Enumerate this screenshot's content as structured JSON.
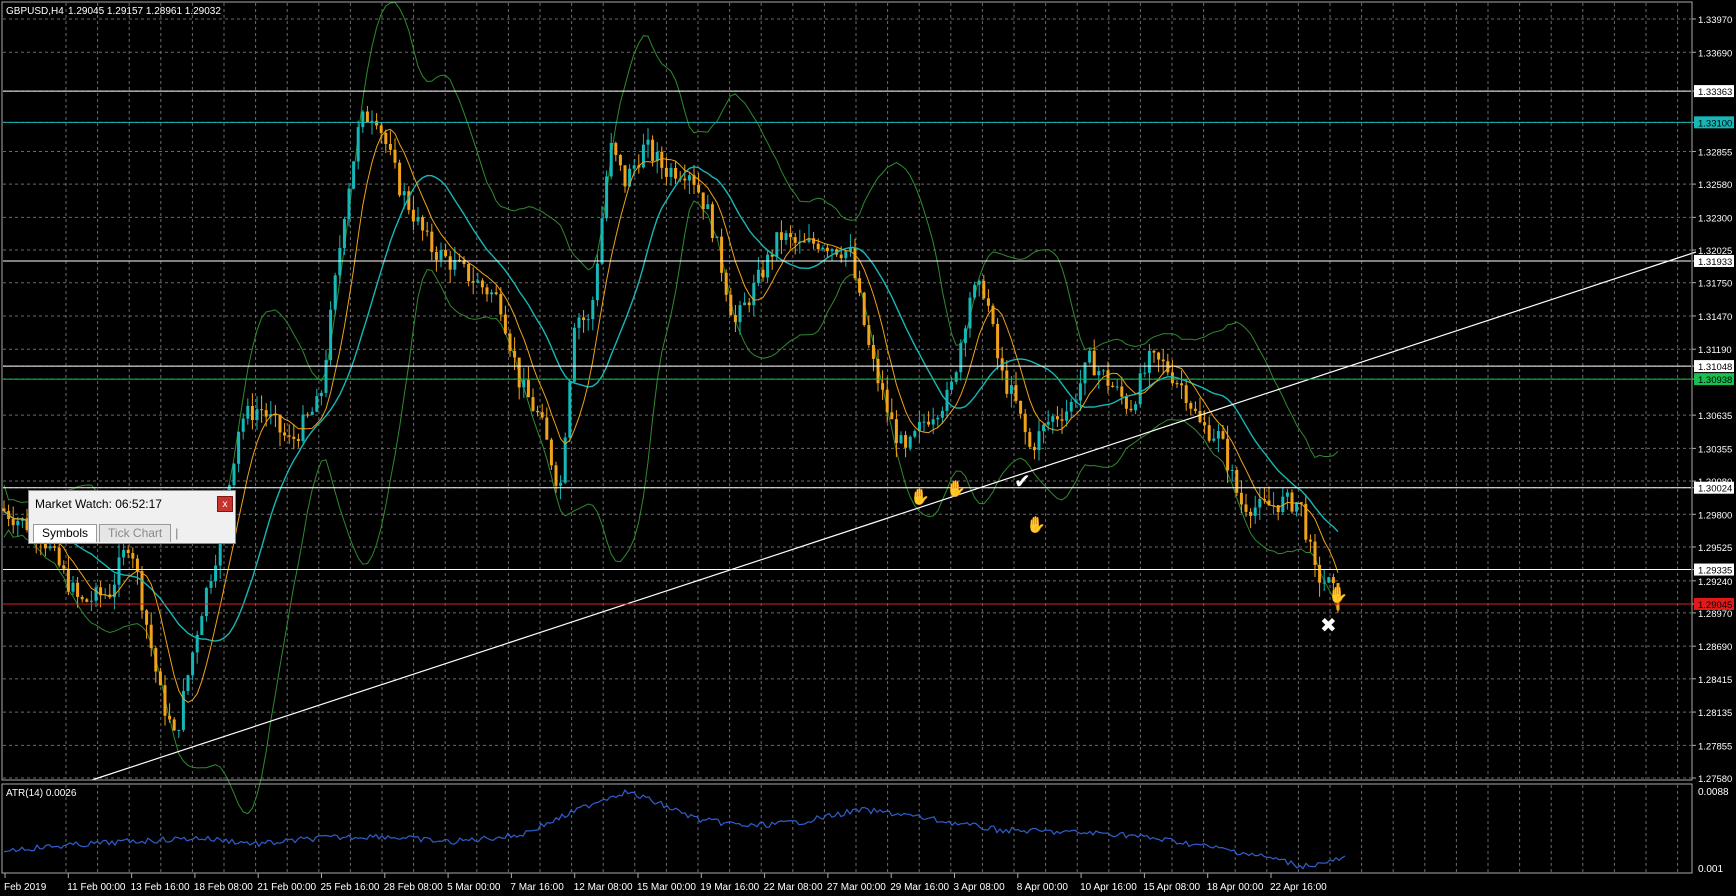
{
  "header": {
    "symbol": "GBPUSD,H4",
    "ohlc": "1.29045 1.29157 1.28961 1.29032"
  },
  "price_axis": {
    "labels": [
      "1.33970",
      "1.33690",
      "1.33363",
      "1.33100",
      "1.32855",
      "1.32580",
      "1.32300",
      "1.32025",
      "1.31933",
      "1.31750",
      "1.31470",
      "1.31190",
      "1.31048",
      "1.30938",
      "1.30635",
      "1.30355",
      "1.30080",
      "1.30024",
      "1.29800",
      "1.29525",
      "1.29335",
      "1.29240",
      "1.29045",
      "1.28970",
      "1.28690",
      "1.28415",
      "1.28135",
      "1.27855",
      "1.27580"
    ],
    "highlighted": [
      {
        "label": "1.33363",
        "color": "#ffffff",
        "text_color": "#000000"
      },
      {
        "label": "1.33100",
        "color": "#17b7b7",
        "text_color": "#000000"
      },
      {
        "label": "1.31933",
        "color": "#ffffff",
        "text_color": "#000000"
      },
      {
        "label": "1.31048",
        "color": "#ffffff",
        "text_color": "#000000"
      },
      {
        "label": "1.30938",
        "color": "#17c04f",
        "text_color": "#000000"
      },
      {
        "label": "1.30024",
        "color": "#ffffff",
        "text_color": "#000000"
      },
      {
        "label": "1.29335",
        "color": "#ffffff",
        "text_color": "#000000"
      },
      {
        "label": "1.29045",
        "color": "#e01a1a",
        "text_color": "#000000"
      }
    ]
  },
  "time_axis": {
    "labels": [
      "Feb 2019",
      "11 Feb 00:00",
      "13 Feb 16:00",
      "18 Feb 08:00",
      "21 Feb 00:00",
      "25 Feb 16:00",
      "28 Feb 08:00",
      "5 Mar 00:00",
      "7 Mar 16:00",
      "12 Mar 08:00",
      "15 Mar 00:00",
      "19 Mar 16:00",
      "22 Mar 08:00",
      "27 Mar 00:00",
      "29 Mar 16:00",
      "3 Apr 08:00",
      "8 Apr 00:00",
      "10 Apr 16:00",
      "15 Apr 08:00",
      "18 Apr 00:00",
      "22 Apr 16:00"
    ]
  },
  "indicator": {
    "label": "ATR(14) 0.0026",
    "top_value": "0.0088",
    "bottom_value": "0.001"
  },
  "horizontal_levels": [
    {
      "price": 1.33363,
      "color": "#ffffff"
    },
    {
      "price": 1.331,
      "color": "#17b7b7"
    },
    {
      "price": 1.31933,
      "color": "#ffffff"
    },
    {
      "price": 1.31048,
      "color": "#ffffff"
    },
    {
      "price": 1.30938,
      "color": "#17c04f"
    },
    {
      "price": 1.30024,
      "color": "#ffffff"
    },
    {
      "price": 1.29335,
      "color": "#ffffff"
    },
    {
      "price": 1.29045,
      "color": "#e01a1a"
    }
  ],
  "market_watch": {
    "title": "Market Watch: 06:52:17",
    "close_label": "x",
    "tabs": [
      "Symbols",
      "Tick Chart"
    ],
    "active_tab": "Symbols"
  },
  "colors": {
    "bull_candle": "#17b7b7",
    "bear_candle": "#f0a21a",
    "bands": "#2f8a2f",
    "ma_fast": "#17b7b7",
    "ma_slow": "#f0a21a",
    "atr": "#2f5fd0",
    "grid": "#6a6a6a"
  }
}
